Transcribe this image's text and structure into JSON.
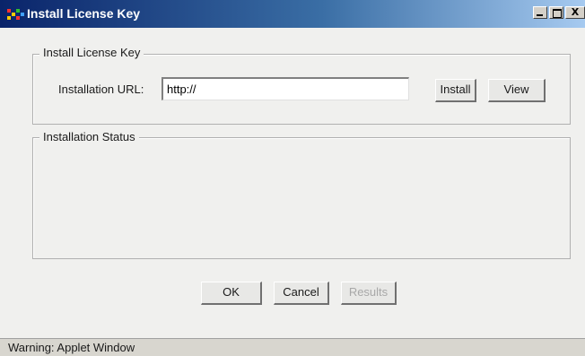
{
  "window": {
    "title": "Install License Key",
    "controls": {
      "minimize": "minimize",
      "maximize": "maximize",
      "close": "X"
    }
  },
  "license_group": {
    "legend": "Install License Key",
    "url_label": "Installation URL:",
    "url_value": "http://",
    "install_label": "Install",
    "view_label": "View"
  },
  "status_group": {
    "legend": "Installation Status",
    "content": ""
  },
  "footer_buttons": {
    "ok_label": "OK",
    "cancel_label": "Cancel",
    "results_label": "Results",
    "results_enabled": false
  },
  "statusbar": {
    "text": "Warning: Applet Window"
  },
  "colors": {
    "titlebar_start": "#0a246a",
    "titlebar_end": "#a6caf0",
    "window_bg": "#f0f0ee",
    "statusbar_bg": "#d8d6cf"
  },
  "icons": {
    "app_icon": "java-applet-icon",
    "minimize": "minimize-icon",
    "maximize": "maximize-icon",
    "close": "close-icon"
  }
}
